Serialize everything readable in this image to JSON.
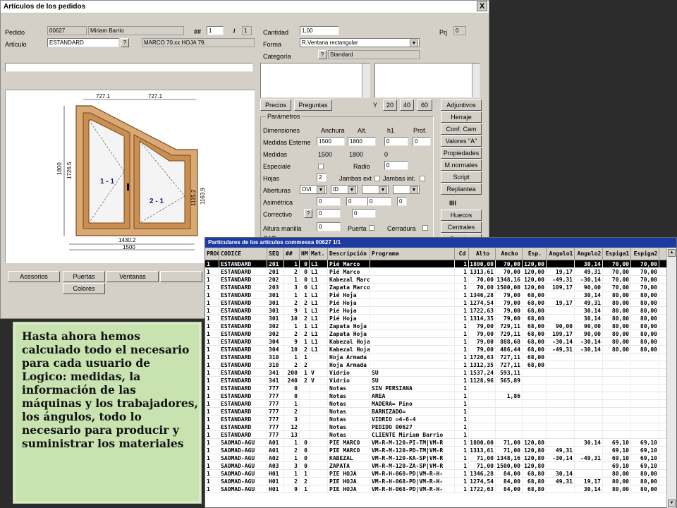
{
  "window": {
    "title": "Artículos de los pedidos",
    "close_label": "X",
    "pedido": {
      "label": "Pedido",
      "number": "00627",
      "client": "Miriam Barrio",
      "hash": "##",
      "line": "1",
      "slash": "/",
      "total": "1"
    },
    "articulo": {
      "label": "Artículo",
      "code": "ESTANDARD",
      "q": "?",
      "description": "MARCO 70.xx HOJA 79."
    },
    "cantidad": {
      "label": "Cantidad",
      "value": "1,00"
    },
    "prj": {
      "label": "Prj",
      "value": "0"
    },
    "forma": {
      "label": "Forma",
      "value": "R.Ventana rectangular"
    },
    "categoria": {
      "label": "Categoría",
      "q": "?",
      "value": "Standard"
    },
    "buttons": {
      "precios": "Precios",
      "preguntas": "Preguntas",
      "y": "Y",
      "y20": "20",
      "y40": "40",
      "y60": "60"
    },
    "side_buttons": [
      "Adjuntivos",
      "Herraje",
      "Conf. Cam",
      "Valores \"A\"",
      "Propiedades",
      "M.normales",
      "Script",
      "Replantea"
    ],
    "side_buttons2": [
      "Huecos",
      "Centrales",
      "Zocalos"
    ],
    "bottom_buttons": {
      "accesorios": "Acesorios",
      "puertas": "Puertas",
      "ventanas": "Ventanas",
      "colores": "Colores"
    },
    "params": {
      "title": "Parámetros",
      "dimensiones": "Dimensiones",
      "anchura": "Anchura",
      "alt": "Alt.",
      "h1": "h1",
      "prof": "Prof.",
      "medidas_esterne": "Medidas Esterne",
      "me_values": [
        "1500",
        "1800",
        "0",
        "0"
      ],
      "medidas": "Medidas",
      "m_values": [
        "1500",
        "1800",
        "0"
      ],
      "especiale": "Especiale",
      "radio": "Radio",
      "radio_value": "0",
      "hojas": "Hojas",
      "hojas_value": "2",
      "jambas_ext": "Jambas ext",
      "jambas_int": "Jambas int.",
      "aberturas": "Aberturas",
      "ab_values": [
        "OVI",
        "ID"
      ],
      "asimetrica": "Asimétrica",
      "as_values": [
        "0",
        "0",
        "0",
        "0"
      ],
      "correctivo": "Correctivo",
      "co_values": [
        "0",
        "0"
      ],
      "altura_manilla": "Altura manilla",
      "am_value": "0",
      "puerta": "Puerta",
      "cerradura": "Cerradura",
      "cad": "CAD",
      "iiii": "IIII"
    },
    "drawing": {
      "dim_top_left": "727.1",
      "dim_top_right": "727.1",
      "dim_left_outer": "1800",
      "dim_left_inner": "1726.5",
      "dim_right_outer": "1163.9",
      "dim_right_inner": "1115.2",
      "dim_bottom_inner": "1430.2",
      "dim_bottom_outer": "1500",
      "label_left": "1 - 1",
      "label_right": "2 - 1"
    }
  },
  "table": {
    "title": "Particulares de los artículos commessa 00627   1/1",
    "columns": [
      "PROC",
      "CODICE",
      "SEQ",
      "##",
      "HM",
      "Mat.",
      "Descripción",
      "Programa",
      "Cd",
      "Alto",
      "Ancho",
      "Esp.",
      "Angulo1",
      "Angulo2",
      "Espiga1",
      "Espiga2"
    ],
    "rows": [
      [
        "1",
        "ESTANDARD",
        "201",
        "1",
        "0",
        "L1",
        "Pié Marco",
        "",
        "1",
        "1800,00",
        "70,00",
        "120,00",
        "",
        "30,14",
        "70,00",
        "70,00"
      ],
      [
        "1",
        "ESTANDARD",
        "201",
        "2",
        "0",
        "L1",
        "Pié Marco",
        "",
        "1",
        "1313,61",
        "70,00",
        "120,00",
        "19,17",
        "49,31",
        "70,00",
        "70,00"
      ],
      [
        "1",
        "ESTANDARD",
        "202",
        "1",
        "0",
        "L1",
        "Kabezal Marc",
        "",
        "1",
        "70,00",
        "1348,16",
        "120,00",
        "-49,31",
        "-30,14",
        "70,00",
        "70,00"
      ],
      [
        "1",
        "ESTANDARD",
        "203",
        "3",
        "0",
        "L1",
        "Zapata Marco",
        "",
        "1",
        "70,00",
        "1500,00",
        "120,00",
        "109,17",
        "90,00",
        "70,00",
        "70,00"
      ],
      [
        "1",
        "ESTANDARD",
        "301",
        "1",
        "1",
        "L1",
        "Pié Hoja",
        "",
        "1",
        "1346,28",
        "79,00",
        "68,00",
        "",
        "30,14",
        "80,00",
        "80,00"
      ],
      [
        "1",
        "ESTANDARD",
        "301",
        "2",
        "2",
        "L1",
        "Pié Hoja",
        "",
        "1",
        "1274,54",
        "79,00",
        "68,00",
        "19,17",
        "49,31",
        "80,00",
        "80,00"
      ],
      [
        "1",
        "ESTANDARD",
        "301",
        "9",
        "1",
        "L1",
        "Pié Hoja",
        "",
        "1",
        "1722,63",
        "79,00",
        "68,00",
        "",
        "30,14",
        "80,00",
        "80,00"
      ],
      [
        "1",
        "ESTANDARD",
        "301",
        "10",
        "2",
        "L1",
        "Pié Hoja",
        "",
        "1",
        "1314,35",
        "79,00",
        "68,00",
        "",
        "30,14",
        "80,00",
        "80,00"
      ],
      [
        "1",
        "ESTANDARD",
        "302",
        "1",
        "1",
        "L1",
        "Zapata Hoja",
        "",
        "1",
        "79,00",
        "729,11",
        "68,00",
        "90,00",
        "90,00",
        "80,00",
        "80,00"
      ],
      [
        "1",
        "ESTANDARD",
        "302",
        "2",
        "2",
        "L1",
        "Zapata Hoja",
        "",
        "1",
        "79,00",
        "729,11",
        "68,00",
        "109,17",
        "90,00",
        "80,00",
        "80,00"
      ],
      [
        "1",
        "ESTANDARD",
        "304",
        "9",
        "1",
        "L1",
        "Kabezal Hoja",
        "",
        "1",
        "79,00",
        "888,68",
        "68,00",
        "-30,14",
        "-30,14",
        "80,00",
        "80,00"
      ],
      [
        "1",
        "ESTANDARD",
        "304",
        "10",
        "2",
        "L1",
        "Kabezal Hoja",
        "",
        "1",
        "79,00",
        "486,44",
        "68,00",
        "-49,31",
        "-30,14",
        "80,00",
        "80,00"
      ],
      [
        "1",
        "ESTANDARD",
        "310",
        "1",
        "1",
        "",
        "Hoja Armada",
        "",
        "1",
        "1720,63",
        "727,11",
        "68,00",
        "",
        "",
        "",
        ""
      ],
      [
        "1",
        "ESTANDARD",
        "310",
        "2",
        "2",
        "",
        "Hoja Armada",
        "",
        "1",
        "1312,35",
        "727,11",
        "68,00",
        "",
        "",
        "",
        ""
      ],
      [
        "1",
        "ESTANDARD",
        "341",
        "200",
        "1",
        "V",
        "Vidrio",
        "SU",
        "1",
        "1537,24",
        "593,11",
        "",
        "",
        "",
        "",
        ""
      ],
      [
        "1",
        "ESTANDARD",
        "341",
        "240",
        "2",
        "V",
        "Vidrio",
        "SU",
        "1",
        "1128,96",
        "565,89",
        "",
        "",
        "",
        "",
        ""
      ],
      [
        "1",
        "ESTANDARD",
        "777",
        "0",
        "",
        "",
        "Notas",
        "SIN PERSIANA",
        "1",
        "",
        "",
        "",
        "",
        "",
        "",
        ""
      ],
      [
        "1",
        "ESTANDARD",
        "777",
        "0",
        "",
        "",
        "Notas",
        "AREA",
        "1",
        "",
        "1,86",
        "",
        "",
        "",
        "",
        ""
      ],
      [
        "1",
        "ESTANDARD",
        "777",
        "1",
        "",
        "",
        "Notas",
        "MADERA= Pino",
        "1",
        "",
        "",
        "",
        "",
        "",
        "",
        ""
      ],
      [
        "1",
        "ESTANDARD",
        "777",
        "2",
        "",
        "",
        "Notas",
        "BARNIZADO=",
        "1",
        "",
        "",
        "",
        "",
        "",
        "",
        ""
      ],
      [
        "1",
        "ESTANDARD",
        "777",
        "3",
        "",
        "",
        "Notas",
        "VIDRIO   =4-6-4",
        "1",
        "",
        "",
        "",
        "",
        "",
        "",
        ""
      ],
      [
        "1",
        "ESTANDARD",
        "777",
        "12",
        "",
        "",
        "Notas",
        "PEDIDO 00627",
        "1",
        "",
        "",
        "",
        "",
        "",
        "",
        ""
      ],
      [
        "1",
        "ESTANDARD",
        "777",
        "13",
        "",
        "",
        "Notas",
        "CLIENTE Miriam Barrio",
        "1",
        "",
        "",
        "",
        "",
        "",
        "",
        ""
      ],
      [
        "1",
        "SAOMAD-AGU",
        "A01",
        "1",
        "0",
        "",
        "PIE MARCO",
        "VM-R-M-120-PI-TM|VM-R",
        "1",
        "1800,00",
        "71,00",
        "120,80",
        "",
        "30,14",
        "69,10",
        "69,10"
      ],
      [
        "1",
        "SAOMAD-AGU",
        "A01",
        "2",
        "0",
        "",
        "PIE MARCO",
        "VM-R-M-120-PD-TM|VM-R",
        "1",
        "1313,61",
        "71,00",
        "120,80",
        "49,31",
        "",
        "69,10",
        "69,10"
      ],
      [
        "1",
        "SAOMAD-AGU",
        "A02",
        "1",
        "0",
        "",
        "KABEZAL",
        "VM-R-M-120-KA-SP|VM-R",
        "1",
        "71,00",
        "1348,16",
        "120,80",
        "-30,14",
        "-49,31",
        "69,10",
        "69,10"
      ],
      [
        "1",
        "SAOMAD-AGU",
        "A03",
        "3",
        "0",
        "",
        "ZAPATA",
        "VM-R-M-120-ZA-SP|VM-R",
        "1",
        "71,00",
        "1500,00",
        "120,80",
        "",
        "",
        "69,10",
        "69,10"
      ],
      [
        "1",
        "SAOMAD-AGU",
        "H01",
        "1",
        "1",
        "",
        "PIE HOJA",
        "VM-R-H-068-PD|VM-R-H-",
        "1",
        "1346,28",
        "84,00",
        "68,80",
        "30,14",
        "",
        "80,00",
        "80,00"
      ],
      [
        "1",
        "SAOMAD-AGU",
        "H01",
        "2",
        "2",
        "",
        "PIE HOJA",
        "VM-R-H-068-PD|VM-R-H-",
        "1",
        "1274,54",
        "84,00",
        "68,80",
        "49,31",
        "19,17",
        "80,00",
        "80,00"
      ],
      [
        "1",
        "SAOMAD-AGU",
        "H01",
        "9",
        "1",
        "",
        "PIE HOJA",
        "VM-R-H-068-PD|VM-R-H-",
        "1",
        "1722,63",
        "84,00",
        "68,80",
        "",
        "30,14",
        "80,00",
        "80,00"
      ]
    ]
  },
  "note": {
    "text": "Hasta ahora hemos calculado todo el necesario para cada usuario de Logico: medidas, la información de las máquinas y los trabajadores, los ángulos, todo lo necesario para producir y suministrar los materiales"
  }
}
